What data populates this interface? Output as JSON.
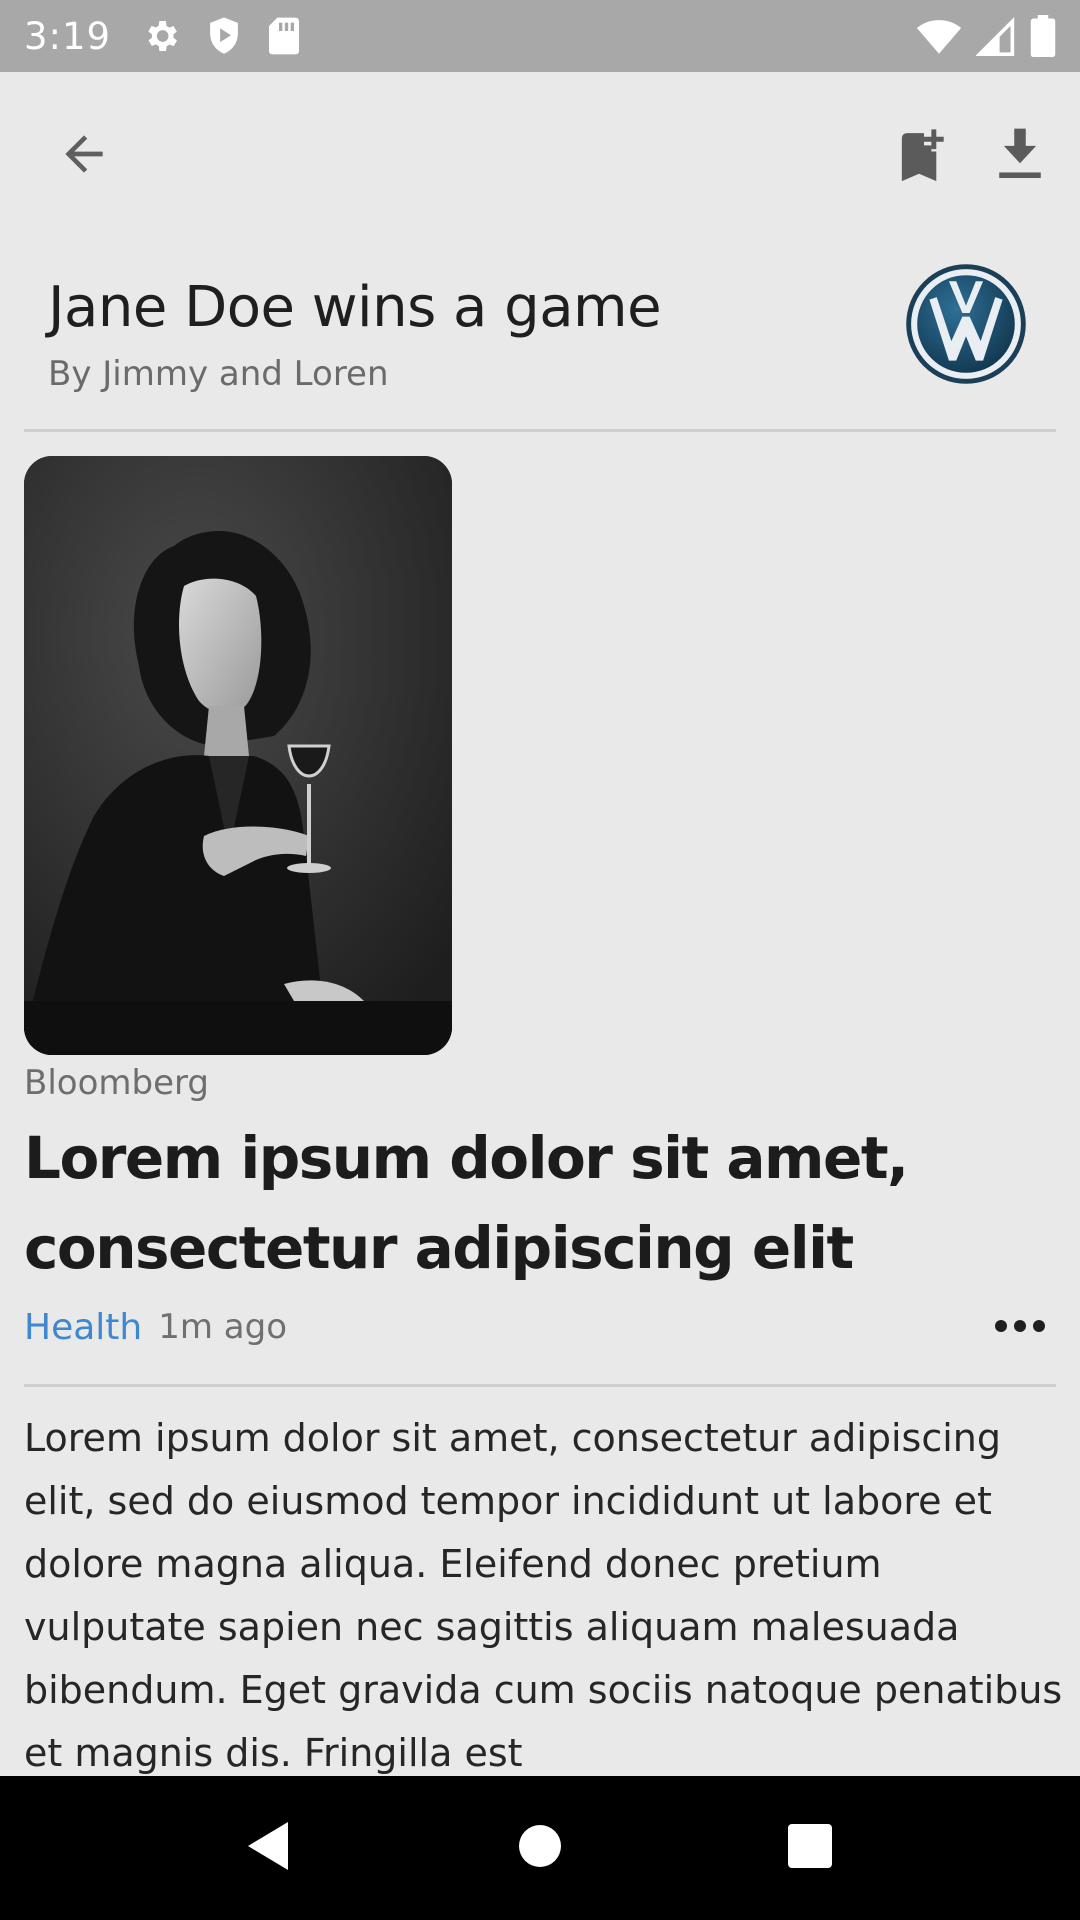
{
  "status_bar": {
    "time": "3:19",
    "icons_left": [
      "gear-icon",
      "play-shield-icon",
      "sd-card-icon"
    ],
    "icons_right": [
      "wifi-icon",
      "cell-signal-icon",
      "battery-icon"
    ]
  },
  "app_bar": {
    "icons": [
      "back-arrow-icon",
      "bookmark-add-icon",
      "download-icon"
    ]
  },
  "header": {
    "title": "Jane Doe wins a game",
    "byline": "By Jimmy and Loren",
    "logo": "volkswagen-logo"
  },
  "article": {
    "image": "portrait-woman-wine-glass",
    "source": "Bloomberg",
    "headline": "Lorem ipsum dolor sit amet, consectetur adipiscing elit",
    "category": "Health",
    "time_ago": "1m ago",
    "more_icon": "more-horizontal-icon",
    "body": "Lorem ipsum dolor sit amet, consectetur adipiscing elit, sed do eiusmod tempor incididunt ut labore et dolore magna aliqua. Eleifend donec pretium vulputate sapien nec sagittis aliquam malesuada bibendum. Eget gravida cum sociis natoque penatibus et magnis dis. Fringilla est"
  },
  "colors": {
    "background": "#e9e9ea",
    "status_bar": "#a8a8a8",
    "category_accent": "#3f88cf",
    "logo_blue": "#1d4f6e",
    "nav_bar": "#000000"
  },
  "nav_bar": {
    "icons": [
      "nav-back-icon",
      "nav-home-icon",
      "nav-recents-icon"
    ]
  }
}
